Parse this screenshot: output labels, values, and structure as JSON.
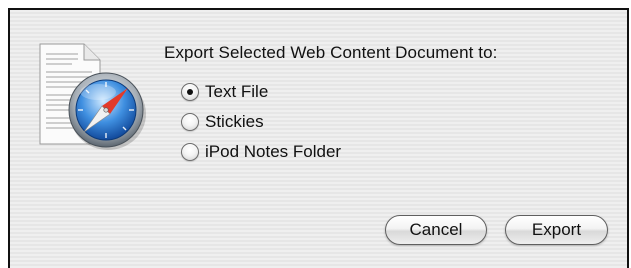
{
  "dialog": {
    "prompt": "Export Selected Web Content Document to:",
    "options": [
      {
        "label": "Text File",
        "selected": true
      },
      {
        "label": "Stickies",
        "selected": false
      },
      {
        "label": "iPod Notes Folder",
        "selected": false
      }
    ],
    "buttons": {
      "cancel": "Cancel",
      "export": "Export"
    },
    "icon": "safari-compass-document-icon"
  }
}
